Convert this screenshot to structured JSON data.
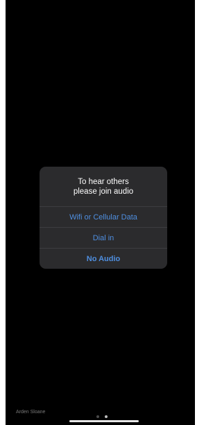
{
  "dialog": {
    "title_line1": "To hear others",
    "title_line2": "please join audio",
    "options": [
      {
        "label": "Wifi or Cellular Data"
      },
      {
        "label": "Dial in"
      },
      {
        "label": "No Audio"
      }
    ]
  },
  "presenter": {
    "name": "Arden Sloane"
  },
  "pager": {
    "page_count": 2,
    "active_page": 2
  },
  "colors": {
    "background": "#000000",
    "dialog_background": "#2b2b2d",
    "accent": "#4f8fe0"
  }
}
